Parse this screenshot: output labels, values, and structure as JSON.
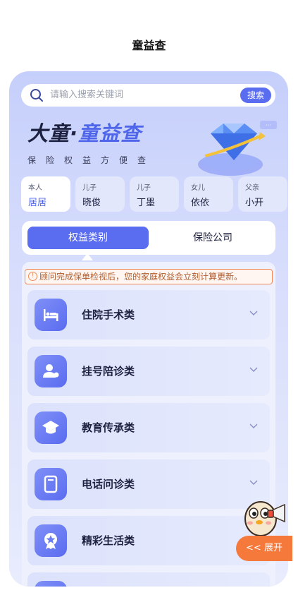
{
  "page": {
    "title": "童益查"
  },
  "search": {
    "placeholder": "请输入搜索关键词",
    "button_label": "搜索"
  },
  "brand": {
    "title_part1": "大童·",
    "title_part2": "童益查",
    "subtitle": "保险权益方便查"
  },
  "members": [
    {
      "relation": "本人",
      "name": "居居",
      "active": true
    },
    {
      "relation": "儿子",
      "name": "晓俊",
      "active": false
    },
    {
      "relation": "儿子",
      "name": "丁墨",
      "active": false
    },
    {
      "relation": "女儿",
      "name": "依依",
      "active": false
    },
    {
      "relation": "父亲",
      "name": "小开",
      "active": false
    }
  ],
  "tabs": [
    {
      "label": "权益类别",
      "active": true
    },
    {
      "label": "保险公司",
      "active": false
    }
  ],
  "notice": {
    "text": "顾问完成保单检视后，您的家庭权益会立刻计算更新。"
  },
  "categories": [
    {
      "label": "住院手术类",
      "icon": "bed-icon"
    },
    {
      "label": "挂号陪诊类",
      "icon": "person-companion-icon"
    },
    {
      "label": "教育传承类",
      "icon": "graduation-cap-icon"
    },
    {
      "label": "电话问诊类",
      "icon": "phone-device-icon"
    },
    {
      "label": "精彩生活类",
      "icon": "star-medal-icon"
    }
  ],
  "expand": {
    "label": "<< 展开"
  },
  "colors": {
    "accent": "#5a6cf0",
    "orange": "#f5793a",
    "notice_border": "#f18a5a"
  }
}
